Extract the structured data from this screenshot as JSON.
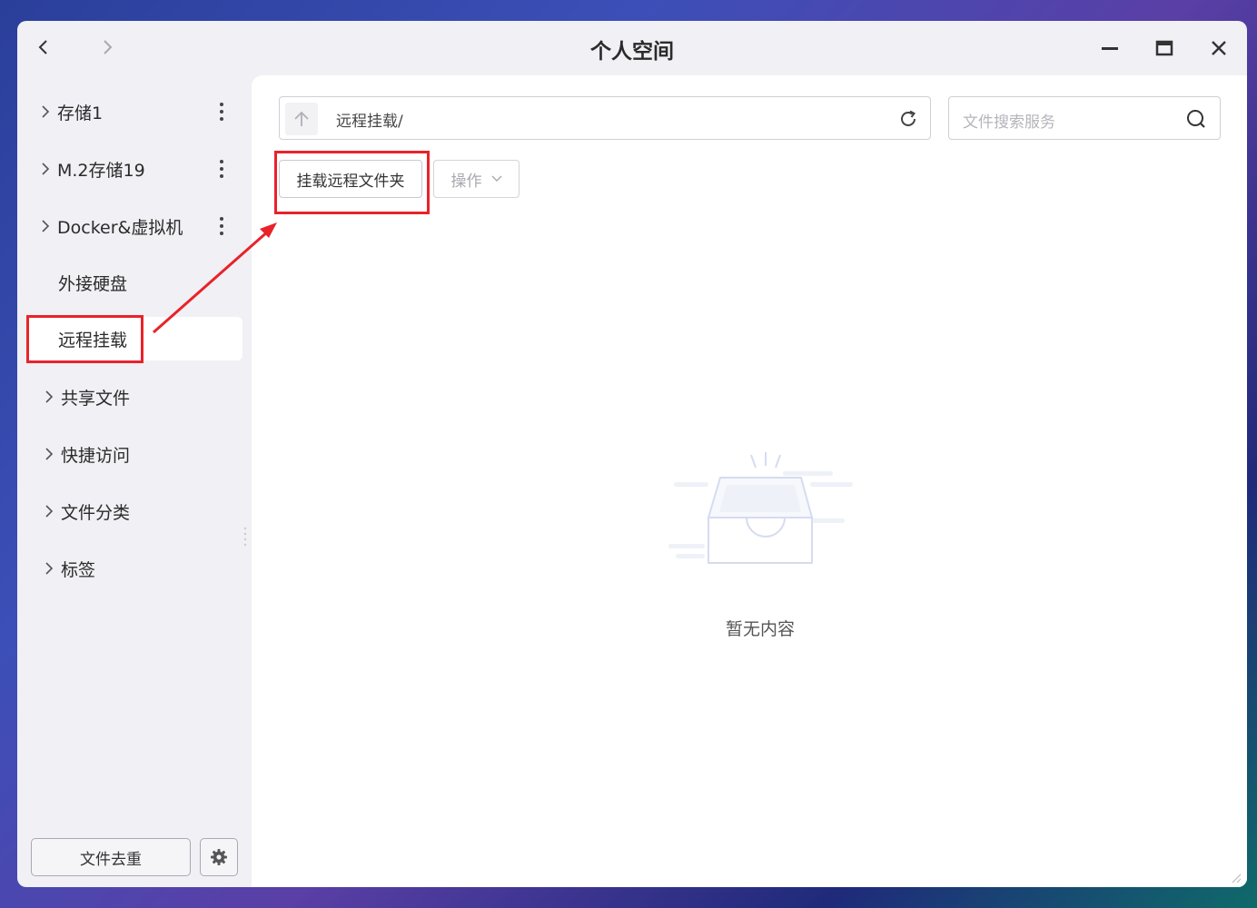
{
  "window": {
    "title": "个人空间"
  },
  "sidebar": {
    "items": [
      {
        "label": "存储1"
      },
      {
        "label": "M.2存储19"
      },
      {
        "label": "Docker&虚拟机"
      },
      {
        "label": "外接硬盘"
      },
      {
        "label": "远程挂载"
      },
      {
        "label": "共享文件"
      },
      {
        "label": "快捷访问"
      },
      {
        "label": "文件分类"
      },
      {
        "label": "标签"
      }
    ],
    "active_item": "远程挂载",
    "dedupe_label": "文件去重"
  },
  "toolbar": {
    "path": "远程挂载/",
    "search_placeholder": "文件搜索服务",
    "mount_label": "挂载远程文件夹",
    "ops_label": "操作"
  },
  "content": {
    "empty_text": "暂无内容"
  },
  "colors": {
    "highlight": "#e8232a",
    "window_bg": "#f0f0f5",
    "main_bg": "#ffffff"
  }
}
